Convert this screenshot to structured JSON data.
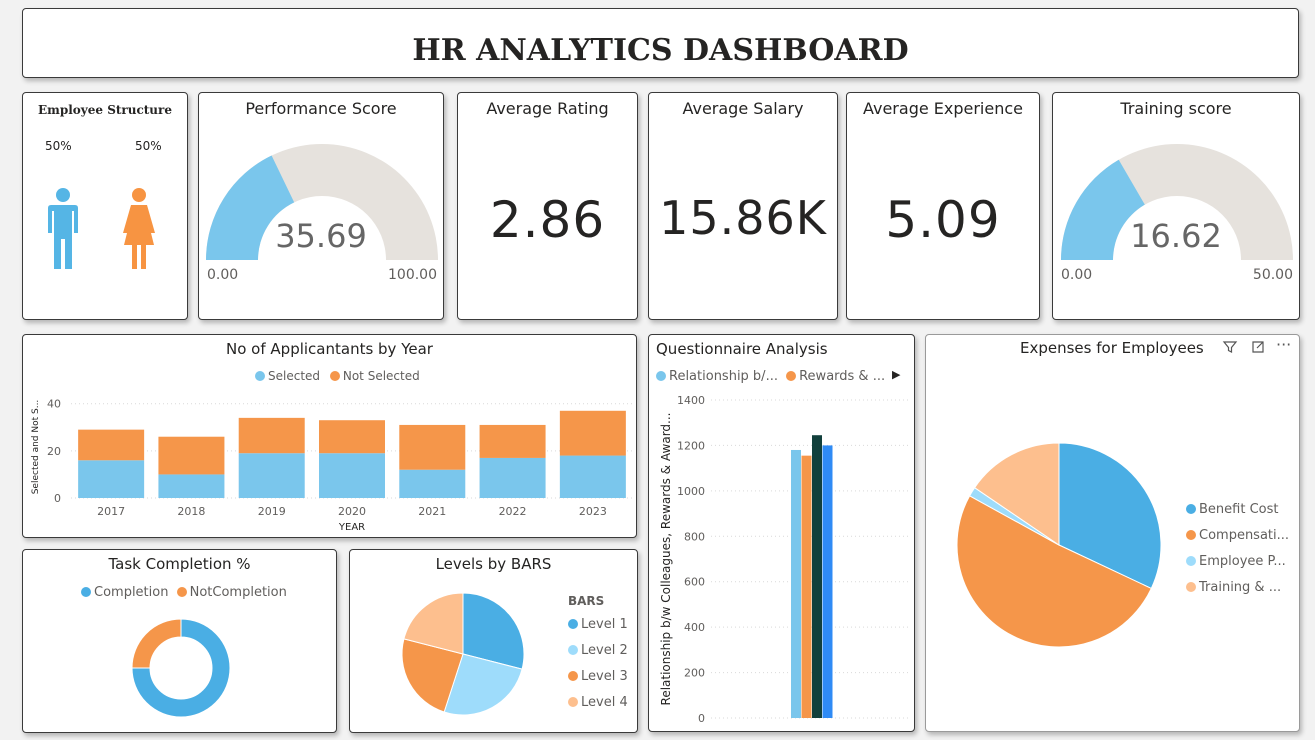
{
  "header": {
    "title": "HR ANALYTICS DASHBOARD"
  },
  "employee_structure": {
    "title": "Employee Structure",
    "male_pct": "50%",
    "female_pct": "50%"
  },
  "performance": {
    "title": "Performance Score",
    "value_label": "35.69",
    "value": 35.69,
    "min": 0,
    "max": 100,
    "min_label": "0.00",
    "max_label": "100.00"
  },
  "rating": {
    "title": "Average Rating",
    "value": "2.86"
  },
  "salary": {
    "title": "Average Salary",
    "value": "15.86K"
  },
  "experience": {
    "title": "Average Experience",
    "value": "5.09"
  },
  "training": {
    "title": "Training score",
    "value_label": "16.62",
    "value": 16.62,
    "min": 0,
    "max": 50,
    "min_label": "0.00",
    "max_label": "50.00"
  },
  "applicants": {
    "title": "No of Applicantants by Year",
    "legend": [
      "Selected",
      "Not Selected"
    ],
    "ylabel": "Selected and Not S...",
    "xlabel": "YEAR",
    "yticks": [
      "0",
      "20",
      "40"
    ]
  },
  "questionnaire": {
    "title": "Questionnaire Analysis",
    "legend": [
      "Relationship b/...",
      "Rewards & ..."
    ],
    "ylabel": "Relationship b/w Colleagues, Rewards & Award...",
    "yticks": [
      "0",
      "200",
      "400",
      "600",
      "800",
      "1000",
      "1200",
      "1400"
    ]
  },
  "expenses": {
    "title": "Expenses for Employees",
    "legend": [
      "Benefit Cost",
      "Compensati...",
      "Employee P...",
      "Training & ..."
    ]
  },
  "task": {
    "title": "Task Completion %",
    "legend": [
      "Completion",
      "NotCompletion"
    ]
  },
  "levels": {
    "title": "Levels by BARS",
    "legend_title": "BARS",
    "legend": [
      "Level 1",
      "Level 2",
      "Level 3",
      "Level 4"
    ]
  },
  "colors": {
    "blue": "#4aaee4",
    "light_blue": "#7ac6ec",
    "orange": "#f5964a",
    "peach": "#fdbf8e",
    "gauge_track": "#e6e2dd",
    "dark_teal": "#12403c",
    "bright_blue": "#2f8bf5",
    "male": "#55b5e5",
    "female": "#f79442",
    "pale_blue": "#9edcfb"
  },
  "chart_data": [
    {
      "type": "bar",
      "stacked": true,
      "title": "No of Applicantants by Year",
      "categories": [
        "2017",
        "2018",
        "2019",
        "2020",
        "2021",
        "2022",
        "2023"
      ],
      "series": [
        {
          "name": "Selected",
          "values": [
            16,
            10,
            19,
            19,
            12,
            17,
            18
          ]
        },
        {
          "name": "Not Selected",
          "values": [
            13,
            16,
            15,
            14,
            19,
            14,
            19
          ]
        }
      ],
      "xlabel": "YEAR",
      "ylabel": "Selected and Not S...",
      "ylim": [
        0,
        42
      ],
      "legend": "top"
    },
    {
      "type": "bar",
      "title": "Questionnaire Analysis",
      "categories": [
        ""
      ],
      "values": [
        1180,
        1155,
        1245,
        1200
      ],
      "ylabel": "Relationship b/w Colleagues, Rewards & Award...",
      "ylim": [
        0,
        1400
      ],
      "legend": "top"
    },
    {
      "type": "pie",
      "title": "Expenses for Employees",
      "labels": [
        "Benefit Cost",
        "Compensati...",
        "Employee P...",
        "Training & ..."
      ],
      "values": [
        32,
        51,
        1.5,
        15.5
      ],
      "legend": "right"
    },
    {
      "type": "pie",
      "donut": true,
      "title": "Task Completion %",
      "labels": [
        "Completion",
        "NotCompletion"
      ],
      "values": [
        75,
        25
      ],
      "legend": "top"
    },
    {
      "type": "pie",
      "title": "Levels by BARS",
      "labels": [
        "Level 1",
        "Level 2",
        "Level 3",
        "Level 4"
      ],
      "values": [
        29,
        26,
        24,
        21
      ],
      "legend": "right"
    }
  ]
}
